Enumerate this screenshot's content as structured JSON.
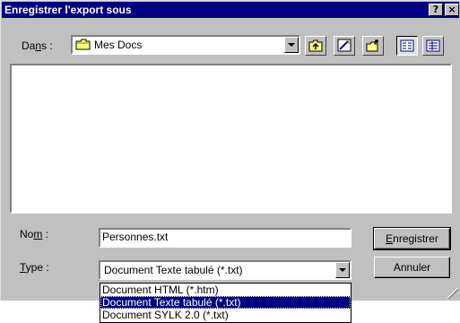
{
  "window": {
    "title": "Enregistrer l'export sous",
    "help_label": "?",
    "close_label": "×"
  },
  "location": {
    "label_pre": "Da",
    "label_u": "n",
    "label_post": "s :",
    "current": "Mes Docs",
    "icon": "folder-icon"
  },
  "toolbar": {
    "buttons": [
      "up-one-level-icon",
      "desktop-icon",
      "new-folder-icon",
      "list-view-icon",
      "details-view-icon"
    ]
  },
  "filename": {
    "label_pre": "No",
    "label_u": "m",
    "label_post": " :",
    "value": "Personnes.txt"
  },
  "filetype": {
    "label_pre": "",
    "label_u": "T",
    "label_post": "ype :",
    "selected": "Document Texte tabulé (*.txt)",
    "options": [
      "Document HTML (*.htm)",
      "Document Texte tabulé (*.txt)",
      "Document SYLK 2.0 (*.txt)"
    ],
    "highlighted_index": 1
  },
  "actions": {
    "save_pre": "",
    "save_u": "E",
    "save_post": "nregistrer",
    "cancel": "Annuler"
  },
  "colors": {
    "titlebar": "#000080",
    "face": "#c0c0c0",
    "highlight": "#000080"
  }
}
